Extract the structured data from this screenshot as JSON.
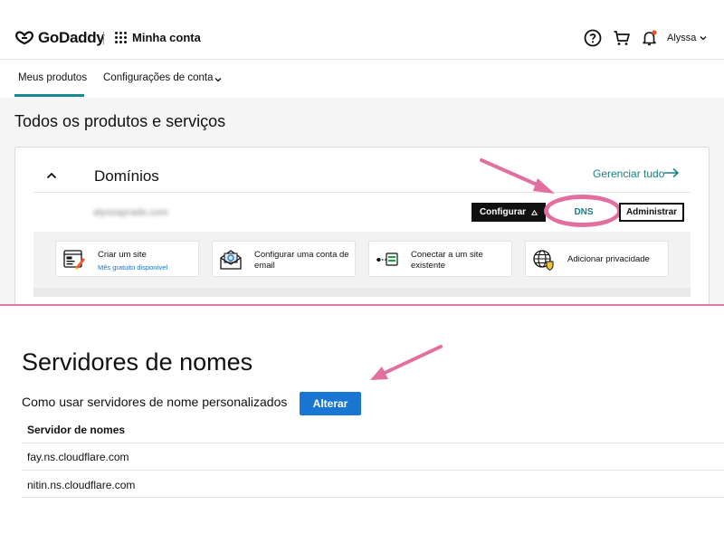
{
  "header": {
    "logo_text": "GoDaddy",
    "app_title": "Minha conta",
    "user_name": "Alyssa"
  },
  "tabs": [
    {
      "label": "Meus produtos",
      "active": true
    },
    {
      "label": "Configurações de conta",
      "active": false
    }
  ],
  "page": {
    "title": "Todos os produtos e serviços"
  },
  "domains_card": {
    "title": "Domínios",
    "manage_all": "Gerenciar tudo",
    "domain": "alyssaprado.com",
    "buttons": {
      "configure": "Configurar",
      "dns": "DNS",
      "admin": "Administrar"
    },
    "actions": [
      {
        "label": "Criar um site",
        "sub": "Mês gratuito disponível",
        "icon": "website-builder-icon"
      },
      {
        "label": "Configurar uma conta de email",
        "sub": "",
        "icon": "email-envelope-icon"
      },
      {
        "label": "Conectar a um site existente",
        "sub": "",
        "icon": "connect-site-icon"
      },
      {
        "label": "Adicionar privacidade",
        "sub": "",
        "icon": "privacy-globe-icon"
      }
    ]
  },
  "nameservers": {
    "title": "Servidores de nomes",
    "howto": "Como usar servidores de nome personalizados",
    "change_button": "Alterar",
    "column_header": "Servidor de nomes",
    "rows": [
      "fay.ns.cloudflare.com",
      "nitin.ns.cloudflare.com"
    ]
  },
  "colors": {
    "accent_teal": "#1b8a8f",
    "annotation_pink": "#e26fa0",
    "primary_blue": "#1976d2"
  }
}
